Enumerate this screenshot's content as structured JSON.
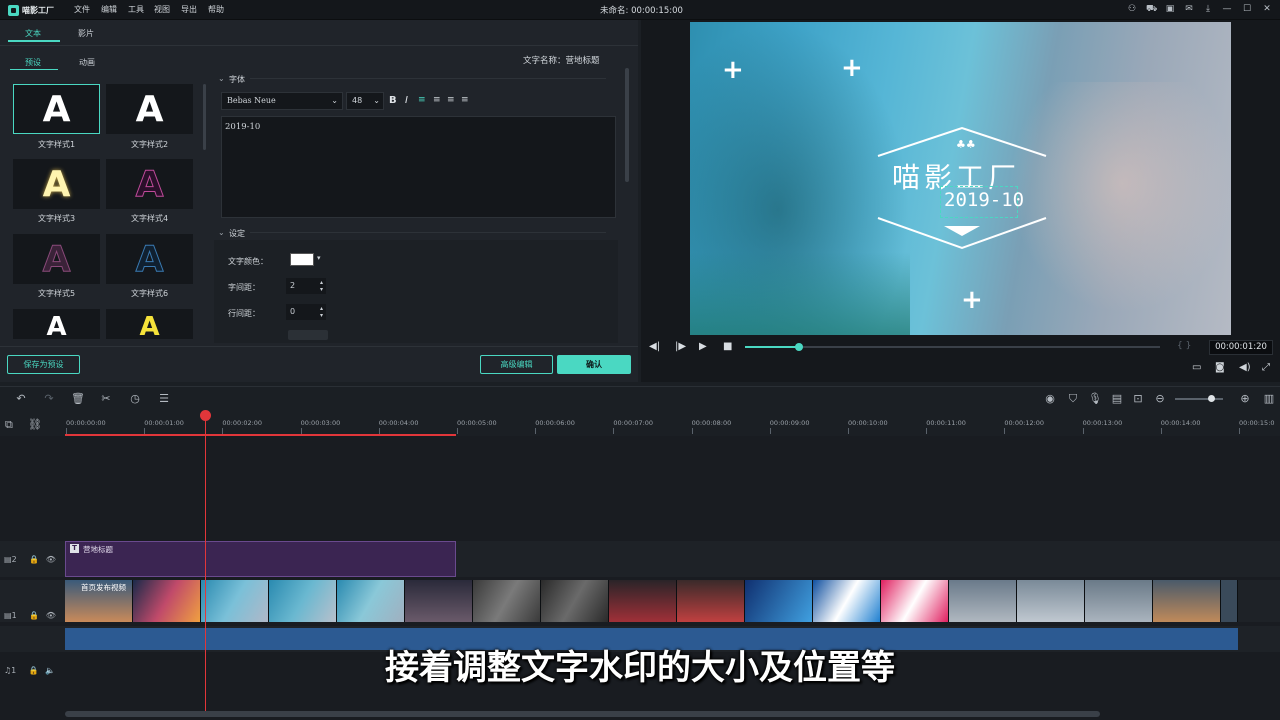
{
  "titlebar": {
    "logo_text": "喵影工厂",
    "menus": [
      "文件",
      "编辑",
      "工具",
      "视图",
      "导出",
      "帮助"
    ],
    "window_title": "未命名: 00:00:15:00"
  },
  "left_panel": {
    "tabs": [
      "文本",
      "影片"
    ],
    "subtabs": [
      "预设",
      "动画"
    ],
    "text_name_label": "文字名称：营地标题",
    "presets": [
      {
        "glyph": "A",
        "label": "文字样式1",
        "color": "#ffffff"
      },
      {
        "glyph": "A",
        "label": "文字样式2",
        "color": "#ffffff"
      },
      {
        "glyph": "A",
        "label": "文字样式3",
        "color": "#fff4b0"
      },
      {
        "glyph": "A",
        "label": "文字样式4",
        "color": "#3a1b3a"
      },
      {
        "glyph": "A",
        "label": "文字样式5",
        "color": "#4a2a44"
      },
      {
        "glyph": "A",
        "label": "文字样式6",
        "color": "#1c3a52"
      },
      {
        "glyph": "A",
        "label": "",
        "color": "#ffffff"
      },
      {
        "glyph": "A",
        "label": "",
        "color": "#f5e23a"
      }
    ],
    "font_section": "字体",
    "font_family": "Bebas Neue",
    "font_size": "48",
    "text_value": "2019-10",
    "settings_section": "设定",
    "text_color_label": "文字颜色：",
    "text_color": "#ffffff",
    "char_spacing_label": "字间距：",
    "char_spacing": "2",
    "line_spacing_label": "行间距：",
    "line_spacing": "0",
    "save_preset": "保存为预设",
    "advanced_edit": "高级编辑",
    "confirm": "确认"
  },
  "preview": {
    "overlay_title": "喵影工厂",
    "overlay_date": "2019-10",
    "timecode": "00:00:01:20",
    "braces": "{ }",
    "progress": 0.13
  },
  "timeline": {
    "ruler_ticks": [
      "00:00:00:00",
      "00:00:01:00",
      "00:00:02:00",
      "00:00:03:00",
      "00:00:04:00",
      "00:00:05:00",
      "00:00:06:00",
      "00:00:07:00",
      "00:00:08:00",
      "00:00:09:00",
      "00:00:10:00",
      "00:00:11:00",
      "00:00:12:00",
      "00:00:13:00",
      "00:00:14:00",
      "00:00:15:0"
    ],
    "title_clip_label": "营地标题",
    "video_clip_label": "首页发布视频",
    "track_labels": [
      "2",
      "1",
      "1"
    ],
    "zoom_level": 0.75
  },
  "subtitle": "接着调整文字水印的大小及位置等",
  "colors": {
    "accent": "#4ad8c2",
    "playhead": "#e2363a",
    "title_clip": "#3b2552",
    "audio": "#2c5a92"
  }
}
